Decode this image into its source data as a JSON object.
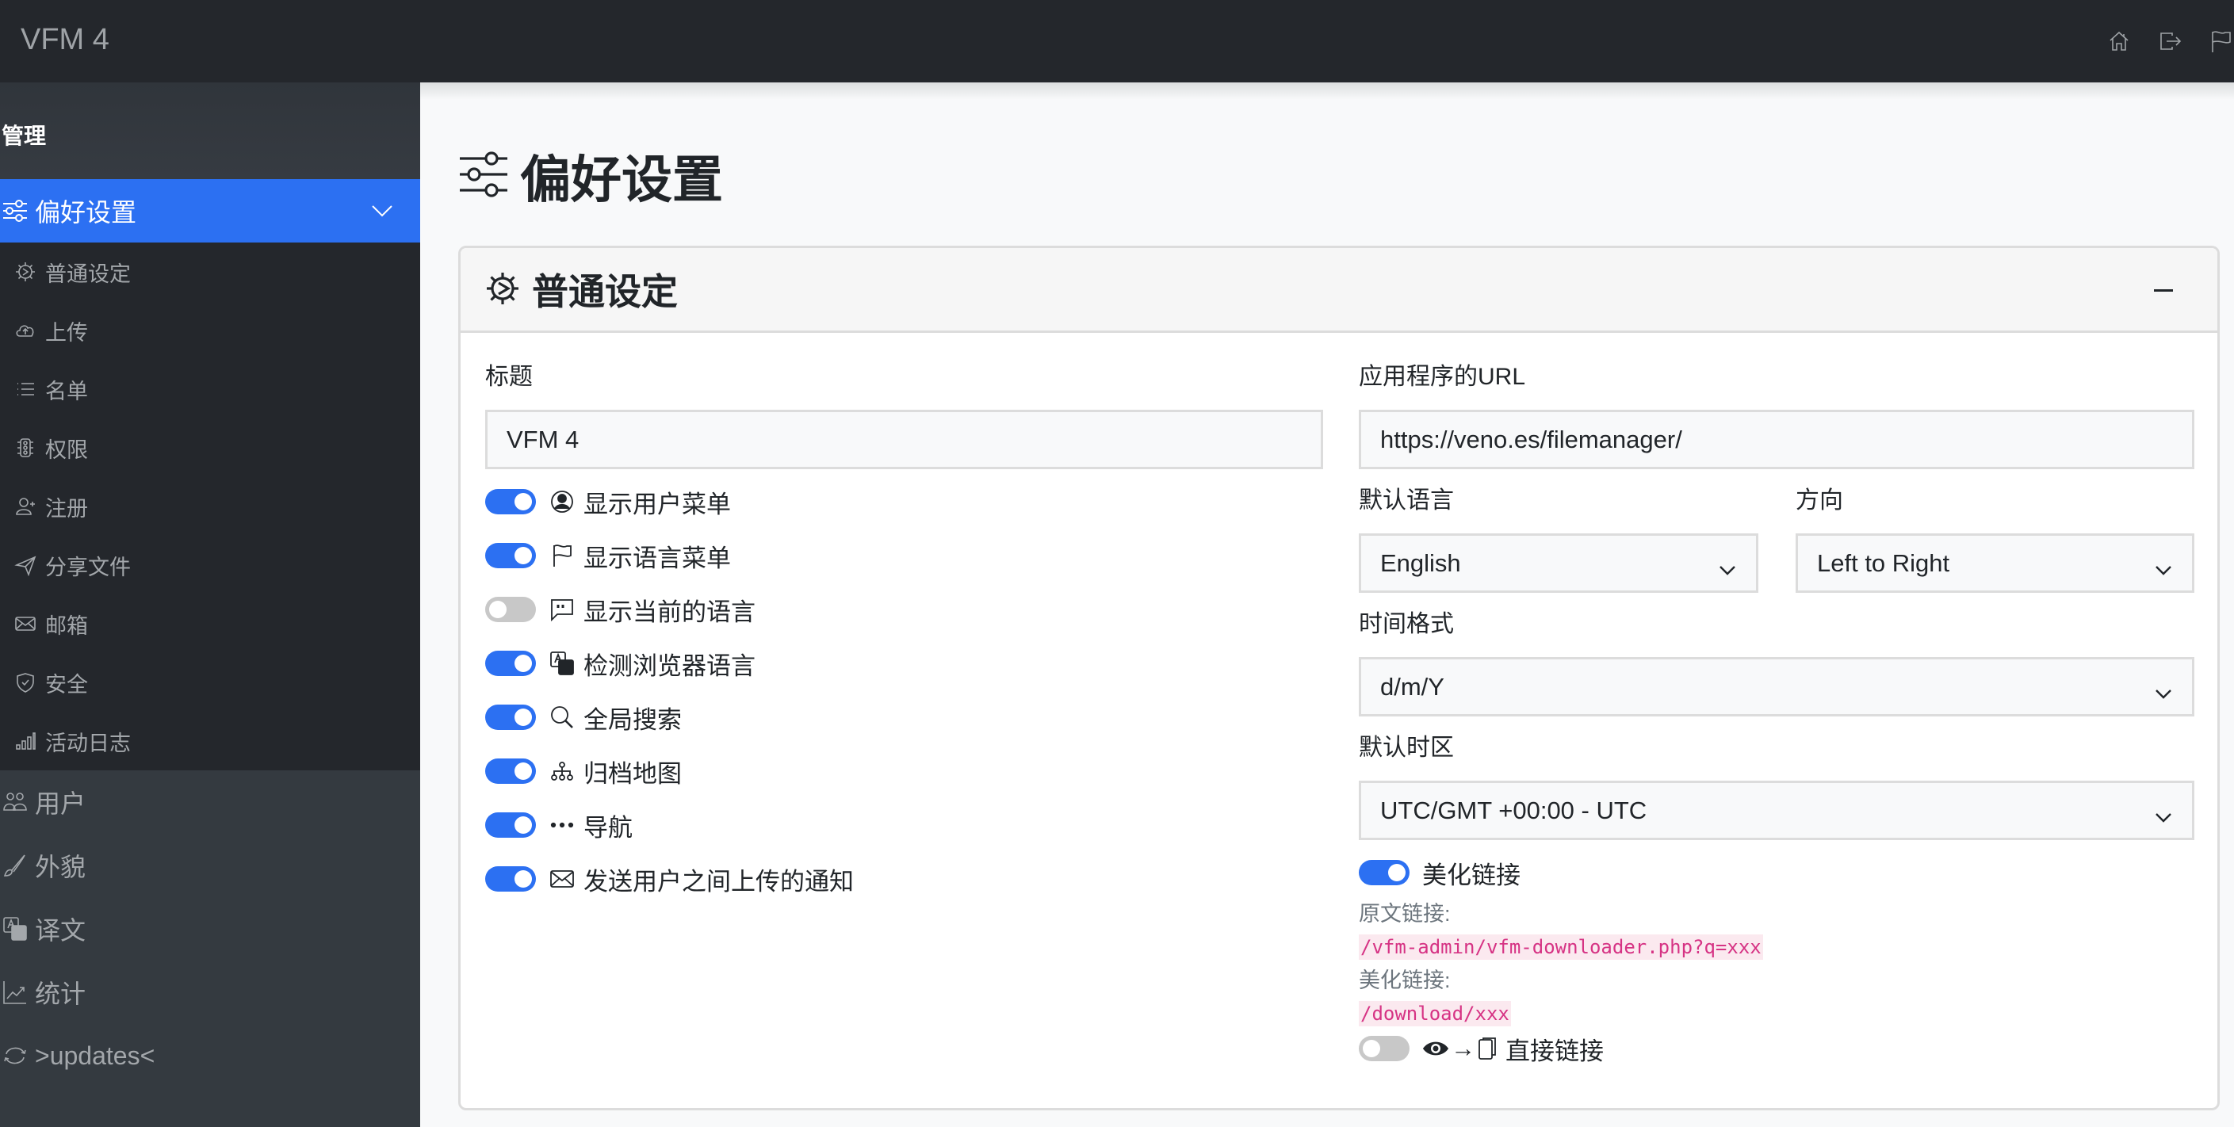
{
  "app": {
    "brand": "VFM 4"
  },
  "navbar": {
    "icons": [
      {
        "name": "home-icon",
        "label": "home"
      },
      {
        "name": "logout-icon",
        "label": "logout"
      },
      {
        "name": "flag-icon",
        "label": "language"
      }
    ]
  },
  "sidebar": {
    "section_title": "管理",
    "active_item": {
      "label": "偏好设置",
      "icon": "sliders-icon",
      "expanded": true
    },
    "sub_items": [
      {
        "label": "普通设定",
        "icon": "gear-icon"
      },
      {
        "label": "上传",
        "icon": "cloud-upload-icon"
      },
      {
        "label": "名单",
        "icon": "list-icon"
      },
      {
        "label": "权限",
        "icon": "traffic-light-icon"
      },
      {
        "label": "注册",
        "icon": "person-plus-icon"
      },
      {
        "label": "分享文件",
        "icon": "send-icon"
      },
      {
        "label": "邮箱",
        "icon": "envelope-icon"
      },
      {
        "label": "安全",
        "icon": "shield-check-icon"
      },
      {
        "label": "活动日志",
        "icon": "bar-chart-icon"
      }
    ],
    "main_items": [
      {
        "label": "用户",
        "icon": "people-icon"
      },
      {
        "label": "外貌",
        "icon": "brush-icon"
      },
      {
        "label": "译文",
        "icon": "translate-icon"
      },
      {
        "label": "统计",
        "icon": "graph-up-icon"
      },
      {
        "label": ">updates<",
        "icon": "arrow-repeat-icon"
      }
    ]
  },
  "page": {
    "title": "偏好设置",
    "card": {
      "title": "普通设定",
      "left": {
        "title_label": "标题",
        "title_value": "VFM 4",
        "toggles": [
          {
            "label": "显示用户菜单",
            "icon": "person-circle-icon",
            "on": true
          },
          {
            "label": "显示语言菜单",
            "icon": "flag-icon",
            "on": true
          },
          {
            "label": "显示当前的语言",
            "icon": "chat-quote-icon",
            "on": false
          },
          {
            "label": "检测浏览器语言",
            "icon": "translate-icon",
            "on": true
          },
          {
            "label": "全局搜索",
            "icon": "search-icon",
            "on": true
          },
          {
            "label": "归档地图",
            "icon": "diagram-icon",
            "on": true
          },
          {
            "label": "导航",
            "icon": "three-dots-icon",
            "on": true
          },
          {
            "label": "发送用户之间上传的通知",
            "icon": "envelope-icon",
            "on": true
          }
        ]
      },
      "right": {
        "url_label": "应用程序的URL",
        "url_value": "https://veno.es/filemanager/",
        "language_label": "默认语言",
        "language_value": "English",
        "direction_label": "方向",
        "direction_value": "Left to Right",
        "time_format_label": "时间格式",
        "time_format_value": "d/m/Y",
        "timezone_label": "默认时区",
        "timezone_value": "UTC/GMT +00:00 - UTC",
        "pretty_links": {
          "label": "美化链接",
          "on": true
        },
        "original_link_label": "原文链接:",
        "original_link_value": "/vfm-admin/vfm-downloader.php?q=xxx",
        "pretty_link_label": "美化链接:",
        "pretty_link_value": "/download/xxx",
        "direct_links": {
          "label": "直接链接",
          "icon_text": "→",
          "on": false
        }
      }
    }
  },
  "colors": {
    "navbar_bg": "#24272c",
    "sidebar_bg": "#343a40",
    "submenu_bg": "#24272c",
    "accent": "#2c70f2",
    "code_color": "#d63384"
  }
}
